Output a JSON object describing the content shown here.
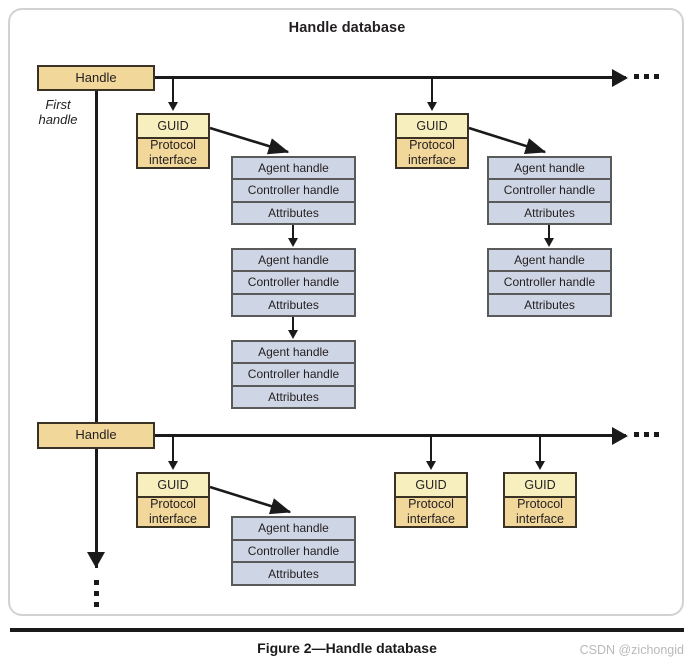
{
  "figure": {
    "diagram_title": "Handle database",
    "caption": "Figure 2—Handle database",
    "watermark": "CSDN @zichongid"
  },
  "annotations": {
    "first_handle_line1": "First",
    "first_handle_line2": "handle",
    "continuation_dots_horizontal": "•••",
    "continuation_dots_vertical": "•••"
  },
  "colors": {
    "handle_fill": "#f2d79b",
    "guid_header_fill": "#f7efbe",
    "protocol_fill": "#f2d79b",
    "record_fill": "#ced5e4",
    "box_border_gold": "#3b3226",
    "box_border_grey": "#5a5a5a",
    "line": "#1a1a1a",
    "panel_border": "#d2d2d2"
  },
  "labels": {
    "handle": "Handle",
    "guid": "GUID",
    "protocol_interface_line1": "Protocol",
    "protocol_interface_line2": "interface",
    "agent_handle": "Agent handle",
    "controller_handle": "Controller handle",
    "attributes": "Attributes"
  },
  "handles": [
    {
      "id": "handle-1",
      "label": "Handle",
      "annotation": "First handle",
      "protocols": [
        {
          "id": "protocol-1-1",
          "guid": "GUID",
          "interface": "Protocol interface",
          "open_records": [
            {
              "agent_handle": "Agent handle",
              "controller_handle": "Controller handle",
              "attributes": "Attributes"
            },
            {
              "agent_handle": "Agent handle",
              "controller_handle": "Controller handle",
              "attributes": "Attributes"
            },
            {
              "agent_handle": "Agent handle",
              "controller_handle": "Controller handle",
              "attributes": "Attributes"
            }
          ]
        },
        {
          "id": "protocol-1-2",
          "guid": "GUID",
          "interface": "Protocol interface",
          "open_records": [
            {
              "agent_handle": "Agent handle",
              "controller_handle": "Controller handle",
              "attributes": "Attributes"
            },
            {
              "agent_handle": "Agent handle",
              "controller_handle": "Controller handle",
              "attributes": "Attributes"
            }
          ]
        }
      ]
    },
    {
      "id": "handle-2",
      "label": "Handle",
      "annotation": "",
      "protocols": [
        {
          "id": "protocol-2-1",
          "guid": "GUID",
          "interface": "Protocol interface",
          "open_records": [
            {
              "agent_handle": "Agent handle",
              "controller_handle": "Controller handle",
              "attributes": "Attributes"
            }
          ]
        },
        {
          "id": "protocol-2-2",
          "guid": "GUID",
          "interface": "Protocol interface",
          "open_records": []
        },
        {
          "id": "protocol-2-3",
          "guid": "GUID",
          "interface": "Protocol interface",
          "open_records": []
        }
      ]
    }
  ]
}
